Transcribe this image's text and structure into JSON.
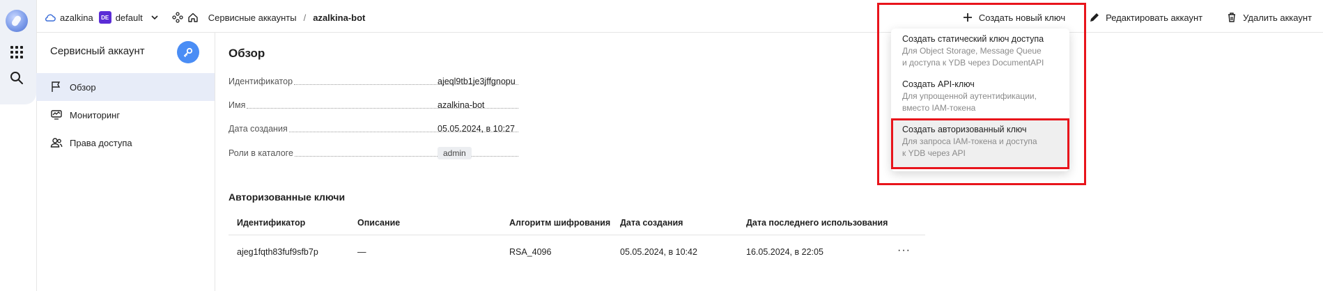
{
  "header": {
    "cloud_name": "azalkina",
    "folder_badge": "DE",
    "folder_name": "default",
    "breadcrumb_section": "Сервисные аккаунты",
    "breadcrumb_separator": "/",
    "breadcrumb_current": "azalkina-bot",
    "actions": {
      "create_key": "Создать новый ключ",
      "edit": "Редактировать аккаунт",
      "delete": "Удалить аккаунт"
    }
  },
  "sidebar": {
    "title": "Сервисный аккаунт",
    "items": [
      {
        "label": "Обзор",
        "icon": "flag-icon",
        "active": true
      },
      {
        "label": "Мониторинг",
        "icon": "monitor-icon",
        "active": false
      },
      {
        "label": "Права доступа",
        "icon": "users-icon",
        "active": false
      }
    ]
  },
  "overview": {
    "title": "Обзор",
    "props": [
      {
        "key": "Идентификатор",
        "value": "ajeql9tb1je3jffgnopu"
      },
      {
        "key": "Имя",
        "value": "azalkina-bot"
      },
      {
        "key": "Дата создания",
        "value": "05.05.2024, в 10:27"
      },
      {
        "key": "Роли в каталоге",
        "value": "admin"
      }
    ]
  },
  "keys": {
    "title": "Авторизованные ключи",
    "columns": [
      "Идентификатор",
      "Описание",
      "Алгоритм шифрования",
      "Дата создания",
      "Дата последнего использования"
    ],
    "rows": [
      [
        "ajeg1fqth83fuf9sfb7p",
        "—",
        "RSA_4096",
        "05.05.2024, в 10:42",
        "16.05.2024, в 22:05"
      ]
    ],
    "row_menu": "···"
  },
  "dropdown": {
    "items": [
      {
        "title": "Создать статический ключ доступа",
        "desc1": "Для Object Storage, Message Queue",
        "desc2": "и доступа к YDB через DocumentAPI"
      },
      {
        "title": "Создать API-ключ",
        "desc1": "Для упрощенной аутентификации,",
        "desc2": "вместо IAM-токена"
      },
      {
        "title": "Создать авторизованный ключ",
        "desc1": "Для запроса IAM-токена и доступа",
        "desc2": "к YDB через API"
      }
    ]
  },
  "colors": {
    "accent": "#4a8df5",
    "highlight_border": "#e8141b",
    "folder_badge": "#5b2dd6",
    "active_nav": "#e7ecf8"
  }
}
